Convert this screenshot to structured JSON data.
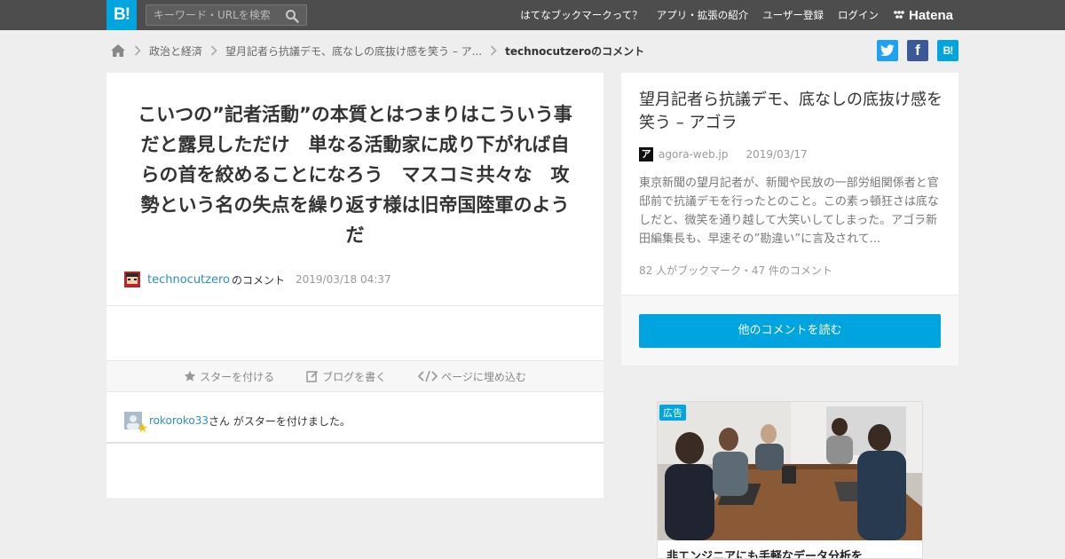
{
  "header": {
    "logo_text": "B!",
    "search_placeholder": "キーワード・URLを検索",
    "nav": [
      "はてなブックマークって？",
      "アプリ・拡張の紹介",
      "ユーザー登録",
      "ログイン"
    ],
    "brand": "Hatena"
  },
  "breadcrumb": {
    "items": [
      "政治と経済",
      "望月記者ら抗議デモ、底なしの底抜け感を笑う – ア..."
    ],
    "current": "technocutzeroのコメント"
  },
  "share": {
    "twitter_icon": "twitter-icon",
    "facebook_label": "f",
    "hatena_label": "B!"
  },
  "comment": {
    "text": "こいつの”記者活動”の本質とはつまりはこういう事だと露見しただけ　単なる活動家に成り下がれば自らの首を絞めることになろう　マスコミ共々な　攻勢という名の失点を繰り返す様は旧帝国陸軍のようだ",
    "author": "technocutzero",
    "author_suffix": "のコメント",
    "timestamp": "2019/03/18 04:37"
  },
  "actions": {
    "star": "スターを付ける",
    "blog": "ブログを書く",
    "embed": "ページに埋め込む"
  },
  "stars": {
    "user": "rokoroko33",
    "message": "さん がスターを付けました。"
  },
  "entry": {
    "title": "望月記者ら抗議デモ、底なしの底抜け感を笑う – アゴラ",
    "favicon_glyph": "ア",
    "domain": "agora-web.jp",
    "date": "2019/03/17",
    "description": "東京新聞の望月記者が、新聞や民放の一部労組関係者と官邸前で抗議デモを行ったとのこと。この素っ頓狂さは底なしだと、微笑を通り越して大笑いしてしまった。アゴラ新田編集長も、早速その”勘違い”に言及されて...",
    "counts": "82 人がブックマーク・47 件のコメント",
    "read_more": "他のコメントを読む"
  },
  "ad": {
    "badge": "広告",
    "title": "非エンジニアにも手軽なデータ分析を"
  },
  "colors": {
    "accent": "#00a4de",
    "header_bg": "#4d4d4d",
    "link": "#2a8fbd",
    "twitter": "#1da1f2",
    "facebook": "#3b5998"
  }
}
